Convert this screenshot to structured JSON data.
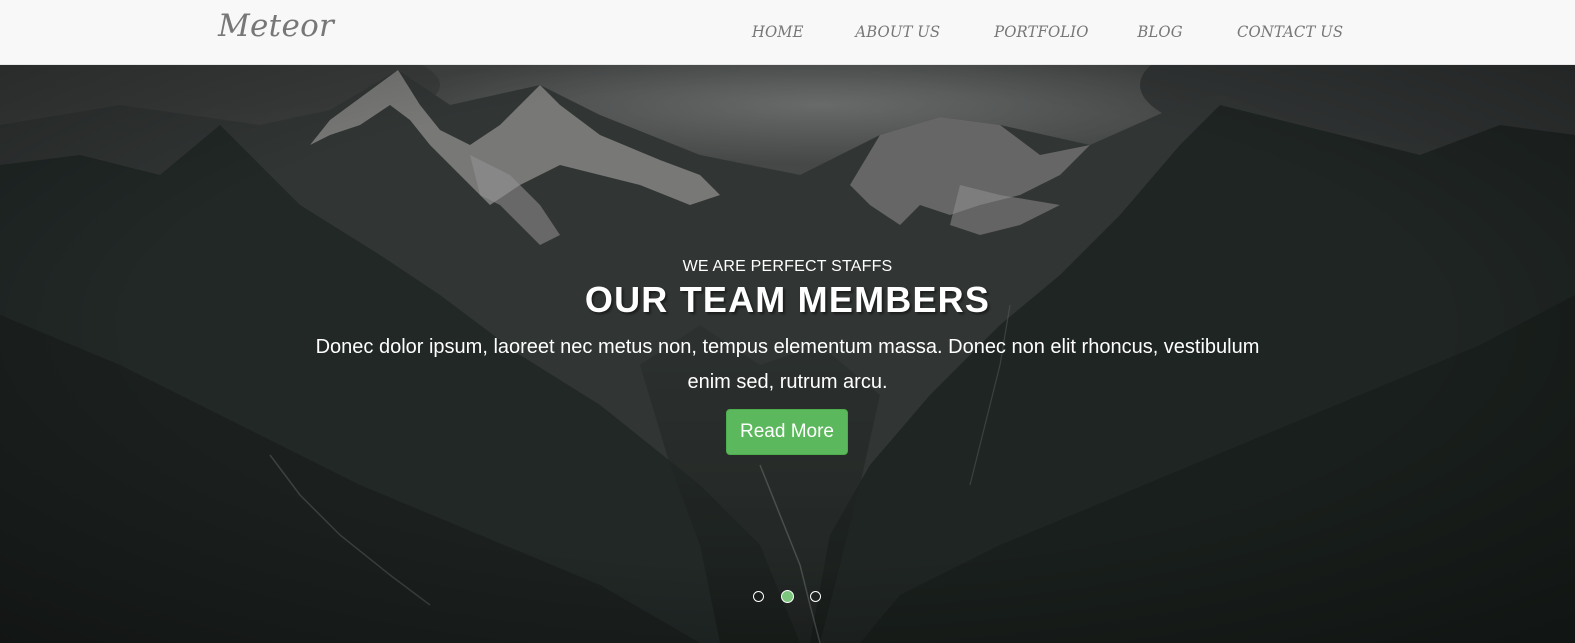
{
  "brand": {
    "name": "Meteor"
  },
  "nav": {
    "items": [
      {
        "label": "HOME"
      },
      {
        "label": "ABOUT US"
      },
      {
        "label": "PORTFOLIO"
      },
      {
        "label": "BLOG"
      },
      {
        "label": "CONTACT US"
      }
    ]
  },
  "hero": {
    "subtitle": "WE ARE PERFECT STAFFS",
    "title": "OUR TEAM MEMBERS",
    "description": "Donec dolor ipsum, laoreet nec metus non, tempus elementum massa. Donec non elit rhoncus, vestibulum enim sed, rutrum arcu.",
    "button_label": "Read More",
    "slide_count": 3,
    "active_slide": 2
  },
  "colors": {
    "navbar_bg": "#f8f8f8",
    "nav_text": "#777777",
    "button_bg": "#5cb85c",
    "active_dot": "#7dc67d"
  }
}
